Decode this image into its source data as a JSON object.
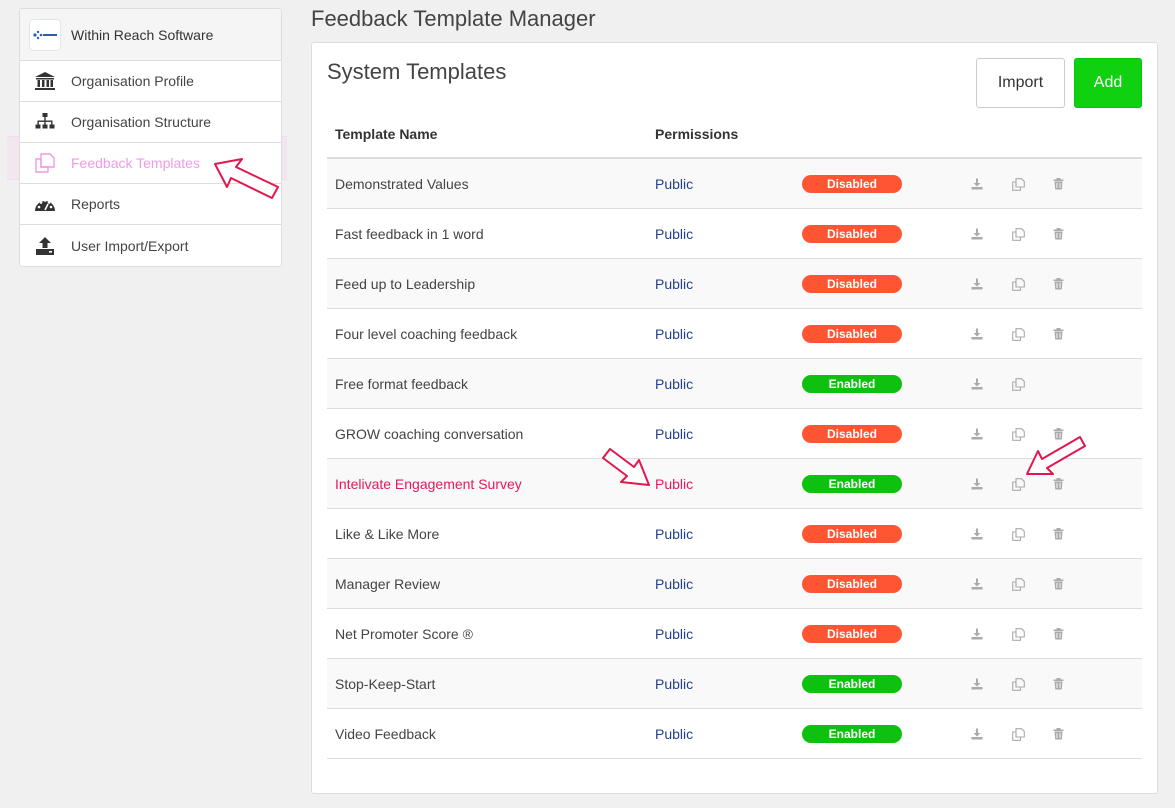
{
  "sidebar": {
    "org_name": "Within Reach Software",
    "items": [
      {
        "label": "Organisation Profile",
        "icon": "bank-icon"
      },
      {
        "label": "Organisation Structure",
        "icon": "sitemap-icon"
      },
      {
        "label": "Feedback Templates",
        "icon": "copy-icon"
      },
      {
        "label": "Reports",
        "icon": "dashboard-icon"
      },
      {
        "label": "User Import/Export",
        "icon": "upload-icon"
      }
    ]
  },
  "page_title": "Feedback Template Manager",
  "panel": {
    "title": "System Templates",
    "import_label": "Import",
    "add_label": "Add"
  },
  "table": {
    "headers": [
      "Template Name",
      "Permissions"
    ],
    "rows": [
      {
        "name": "Demonstrated Values",
        "permission": "Public",
        "status": "Disabled"
      },
      {
        "name": "Fast feedback in 1 word",
        "permission": "Public",
        "status": "Disabled"
      },
      {
        "name": "Feed up to Leadership",
        "permission": "Public",
        "status": "Disabled"
      },
      {
        "name": "Four level coaching feedback",
        "permission": "Public",
        "status": "Disabled"
      },
      {
        "name": "Free format feedback",
        "permission": "Public",
        "status": "Enabled"
      },
      {
        "name": "GROW coaching conversation",
        "permission": "Public",
        "status": "Disabled"
      },
      {
        "name": "Intelivate Engagement Survey",
        "permission": "Public",
        "status": "Enabled"
      },
      {
        "name": "Like & Like More",
        "permission": "Public",
        "status": "Disabled"
      },
      {
        "name": "Manager Review",
        "permission": "Public",
        "status": "Disabled"
      },
      {
        "name": "Net Promoter Score ®",
        "permission": "Public",
        "status": "Disabled"
      },
      {
        "name": "Stop-Keep-Start",
        "permission": "Public",
        "status": "Enabled"
      },
      {
        "name": "Video Feedback",
        "permission": "Public",
        "status": "Enabled"
      }
    ]
  },
  "colors": {
    "add_button": "#0fd10f",
    "disabled_badge": "#ff5533",
    "enabled_badge": "#0ec10e",
    "permission_link": "#24408e",
    "highlight_text": "#e8185c",
    "sidebar_active": "#f29ae6",
    "annotation_arrow": "#e0184d"
  }
}
